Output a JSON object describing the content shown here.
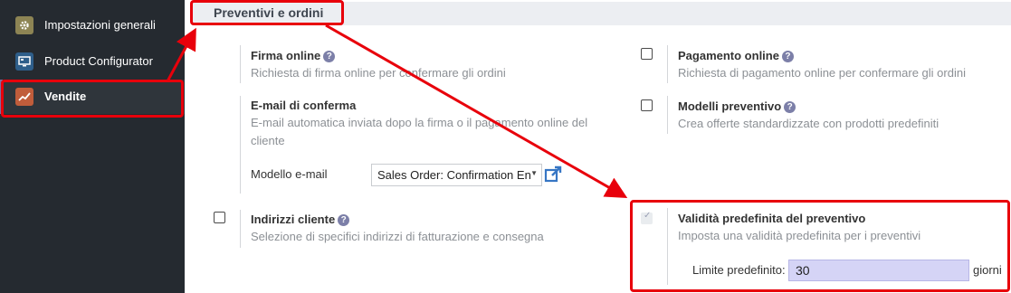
{
  "sidebar": {
    "items": [
      {
        "label": "Impostazioni generali",
        "icon": "gear-icon",
        "color": "#8d8454"
      },
      {
        "label": "Product Configurator",
        "icon": "configurator-icon",
        "color": "#2e5e8a"
      },
      {
        "label": "Vendite",
        "icon": "sales-chart-icon",
        "color": "#c15d3b"
      }
    ]
  },
  "section": {
    "title": "Preventivi e ordini"
  },
  "settings": {
    "online_signature": {
      "title": "Firma online",
      "desc": "Richiesta di firma online per confermare gli ordini"
    },
    "online_payment": {
      "title": "Pagamento online",
      "desc": "Richiesta di pagamento online per confermare gli ordini",
      "checked": false
    },
    "confirmation_email": {
      "title": "E-mail di conferma",
      "desc": "E-mail automatica inviata dopo la firma o il pagamento online del cliente",
      "field_label": "Modello e-mail",
      "field_value": "Sales Order: Confirmation En"
    },
    "quote_templates": {
      "title": "Modelli preventivo",
      "desc": "Crea offerte standardizzate con prodotti predefiniti",
      "checked": false
    },
    "customer_addresses": {
      "title": "Indirizzi cliente",
      "desc": "Selezione di specifici indirizzi di fatturazione e consegna",
      "checked": false
    },
    "default_validity": {
      "title": "Validità predefinita del preventivo",
      "desc": "Imposta una validità predefinita per i preventivi",
      "checked": true,
      "field_label": "Limite predefinito:",
      "field_value": "30",
      "unit": "giorni"
    }
  },
  "colors": {
    "annotation": "#e8000b",
    "sidebar_bg": "#252a30",
    "input_highlight": "#d5d4f6"
  }
}
